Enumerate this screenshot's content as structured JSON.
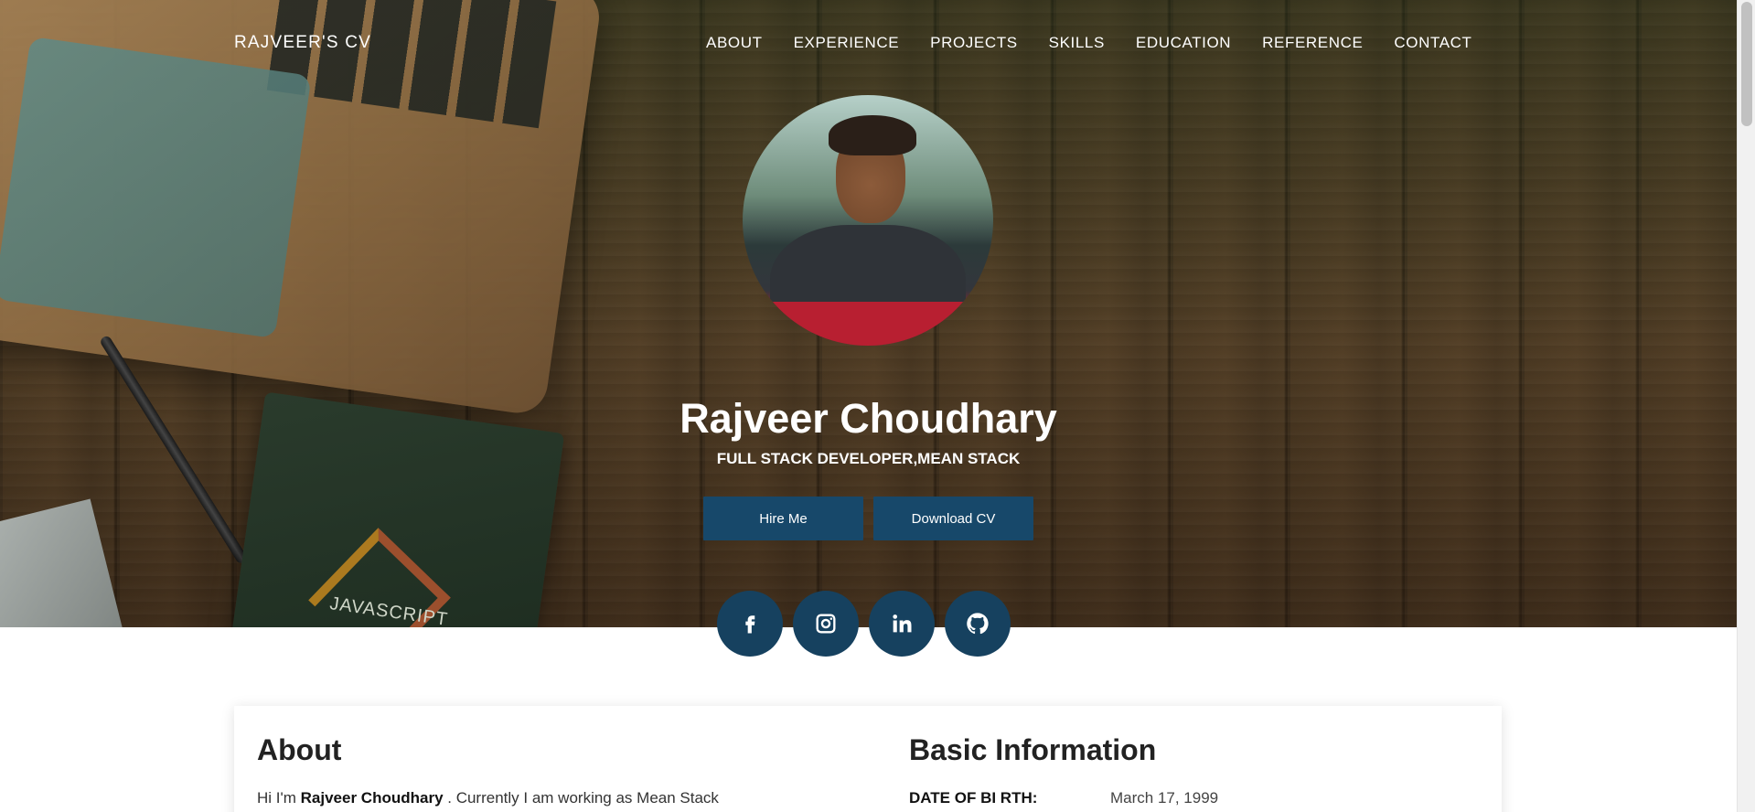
{
  "brand": "RAJVEER'S CV",
  "nav": {
    "items": [
      "ABOUT",
      "EXPERIENCE",
      "PROJECTS",
      "SKILLS",
      "EDUCATION",
      "REFERENCE",
      "CONTACT"
    ]
  },
  "hero": {
    "book_text": "JAVASCRIPT",
    "name": "Rajveer Choudhary",
    "subtitle": "FULL STACK DEVELOPER,MEAN STACK",
    "buttons": {
      "hire": "Hire Me",
      "download": "Download CV"
    },
    "socials": [
      {
        "icon": "facebook-icon"
      },
      {
        "icon": "instagram-icon"
      },
      {
        "icon": "linkedin-icon"
      },
      {
        "icon": "github-icon"
      }
    ]
  },
  "about": {
    "title": "About",
    "text_prefix": "Hi I'm ",
    "text_name": "Rajveer Choudhary",
    "text_suffix": " . Currently I am working as Mean Stack"
  },
  "basic_info": {
    "title": "Basic Information",
    "rows": [
      {
        "label": "DATE OF BI RTH:",
        "value": "March 17, 1999"
      }
    ]
  },
  "colors": {
    "button": "#17486a",
    "social": "#16415f"
  }
}
